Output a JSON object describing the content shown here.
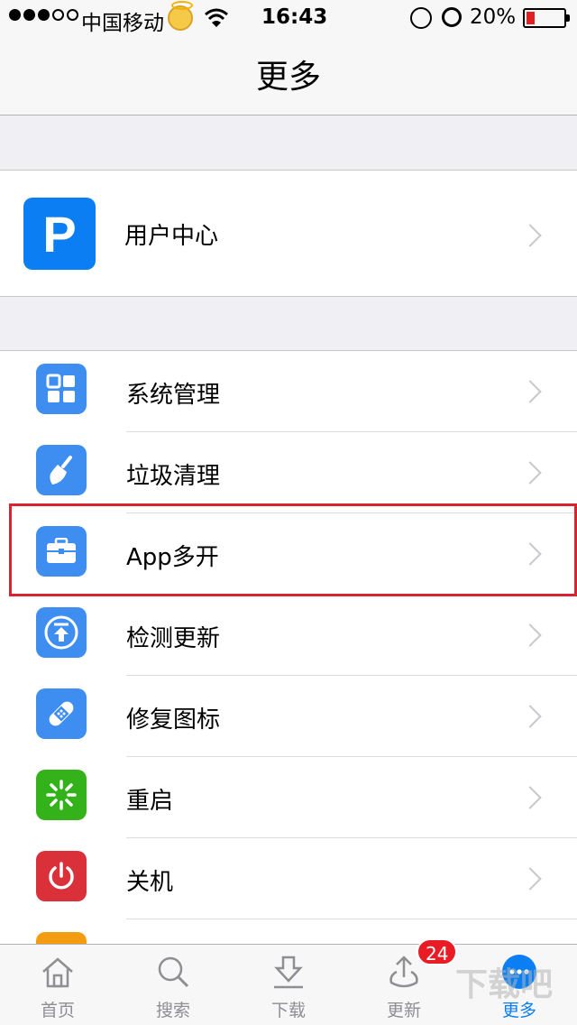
{
  "status_bar": {
    "carrier": "中国移动",
    "time": "16:43",
    "battery_percent": "20%"
  },
  "nav": {
    "title": "更多"
  },
  "user_center": {
    "label": "用户中心",
    "icon": "p-logo-icon"
  },
  "menu_items": [
    {
      "label": "系统管理",
      "icon": "grid-icon",
      "color": "#3d8ef0"
    },
    {
      "label": "垃圾清理",
      "icon": "broom-icon",
      "color": "#3d8ef0"
    },
    {
      "label": "App多开",
      "icon": "toolbox-icon",
      "color": "#3d8ef0"
    },
    {
      "label": "检测更新",
      "icon": "upload-arrow-icon",
      "color": "#3d8ef0"
    },
    {
      "label": "修复图标",
      "icon": "bandage-icon",
      "color": "#3d8ef0"
    },
    {
      "label": "重启",
      "icon": "spinner-icon",
      "color": "#33b21a"
    },
    {
      "label": "关机",
      "icon": "power-icon",
      "color": "#d9303a"
    }
  ],
  "tabs": [
    {
      "label": "首页",
      "icon": "home-icon"
    },
    {
      "label": "搜索",
      "icon": "search-icon"
    },
    {
      "label": "下载",
      "icon": "download-icon"
    },
    {
      "label": "更新",
      "icon": "update-icon",
      "badge": "24"
    },
    {
      "label": "更多",
      "icon": "more-icon",
      "active": true
    }
  ],
  "watermark": "下载吧"
}
